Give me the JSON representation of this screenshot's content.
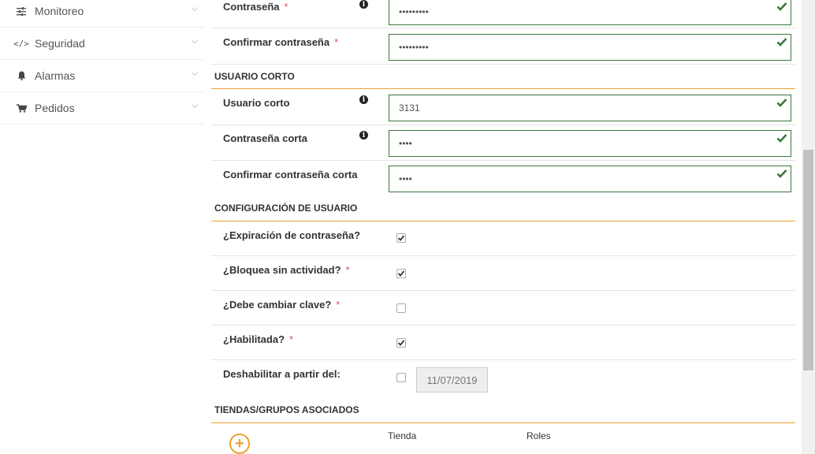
{
  "sidebar": {
    "items": [
      {
        "label": "Monitoreo",
        "icon": "sliders-icon"
      },
      {
        "label": "Seguridad",
        "icon": "code-icon"
      },
      {
        "label": "Alarmas",
        "icon": "bell-icon"
      },
      {
        "label": "Pedidos",
        "icon": "cart-icon"
      }
    ]
  },
  "form": {
    "password": {
      "label": "Contraseña",
      "required": "*",
      "value": "•••••••••"
    },
    "confirm_password": {
      "label": "Confirmar contraseña",
      "required": "*",
      "value": "•••••••••"
    },
    "short_user_section": "USUARIO CORTO",
    "short_user": {
      "label": "Usuario corto",
      "value": "3131"
    },
    "short_password": {
      "label": "Contraseña corta",
      "value": "••••"
    },
    "confirm_short_password": {
      "label": "Confirmar contraseña corta",
      "value": "••••"
    },
    "user_config_section": "CONFIGURACIÓN DE USUARIO",
    "password_expiry": {
      "label": "¿Expiración de contraseña?",
      "checked": true
    },
    "lock_inactivity": {
      "label": "¿Bloquea sin actividad?",
      "required": "*",
      "checked": true
    },
    "must_change_key": {
      "label": "¿Debe cambiar clave?",
      "required": "*",
      "checked": false
    },
    "enabled": {
      "label": "¿Habilitada?",
      "required": "*",
      "checked": true
    },
    "disable_from": {
      "label": "Deshabilitar a partir del:",
      "checked": false,
      "date": "11/07/2019"
    },
    "stores_section": "TIENDAS/GRUPOS ASOCIADOS",
    "stores_table": {
      "col_store": "Tienda",
      "col_roles": "Roles"
    }
  },
  "colors": {
    "valid": "#3c763d",
    "accent": "#f0a030",
    "required": "#d9534f"
  }
}
